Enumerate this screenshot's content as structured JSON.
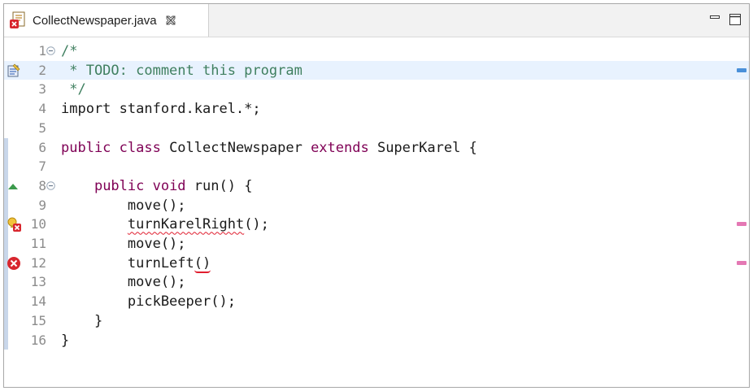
{
  "tab": {
    "title": "CollectNewspaper.java"
  },
  "colors": {
    "keyword": "#7f0055",
    "comment": "#3f7f5f",
    "error": "#e01e2f",
    "highlight_line": "#e8f2fe",
    "overview_task": "#4a90d9",
    "overview_error": "#e478b4"
  },
  "editor": {
    "lines": [
      {
        "num": "1",
        "folded": true,
        "tokens": [
          {
            "t": "/*",
            "c": "cm"
          }
        ]
      },
      {
        "num": "2",
        "tokens": [
          {
            "t": " * TODO: comment this program",
            "c": "cm"
          }
        ],
        "marker": "task-icon",
        "highlight": true
      },
      {
        "num": "3",
        "tokens": [
          {
            "t": " */",
            "c": "cm"
          }
        ]
      },
      {
        "num": "4",
        "tokens": [
          {
            "t": "import stanford.karel.*;",
            "c": ""
          }
        ]
      },
      {
        "num": "5",
        "tokens": []
      },
      {
        "num": "6",
        "tokens": [
          {
            "t": "public class ",
            "c": "kw"
          },
          {
            "t": "CollectNewspaper ",
            "c": ""
          },
          {
            "t": "extends ",
            "c": "kw"
          },
          {
            "t": "SuperKarel {",
            "c": ""
          }
        ]
      },
      {
        "num": "7",
        "tokens": []
      },
      {
        "num": "8",
        "folded": true,
        "marker": "override-icon",
        "tokens": [
          {
            "t": "    ",
            "c": ""
          },
          {
            "t": "public void ",
            "c": "kw"
          },
          {
            "t": "run() {",
            "c": ""
          }
        ]
      },
      {
        "num": "9",
        "tokens": [
          {
            "t": "        move();",
            "c": ""
          }
        ]
      },
      {
        "num": "10",
        "marker": "quickfix-error-icon",
        "tokens": [
          {
            "t": "        ",
            "c": ""
          },
          {
            "t": "turnKarelRight",
            "c": "err"
          },
          {
            "t": "();",
            "c": ""
          }
        ]
      },
      {
        "num": "11",
        "tokens": [
          {
            "t": "        move();",
            "c": ""
          }
        ]
      },
      {
        "num": "12",
        "marker": "error-icon",
        "tokens": [
          {
            "t": "        turnLeft",
            "c": ""
          },
          {
            "t": "()",
            "c": "errparen"
          }
        ]
      },
      {
        "num": "13",
        "tokens": [
          {
            "t": "        move();",
            "c": ""
          }
        ]
      },
      {
        "num": "14",
        "tokens": [
          {
            "t": "        pickBeeper();",
            "c": ""
          }
        ]
      },
      {
        "num": "15",
        "tokens": [
          {
            "t": "    }",
            "c": ""
          }
        ]
      },
      {
        "num": "16",
        "tokens": [
          {
            "t": "}",
            "c": ""
          }
        ]
      }
    ]
  },
  "overview_ruler": [
    {
      "line": "2",
      "kind": "task"
    },
    {
      "line": "10",
      "kind": "error"
    },
    {
      "line": "12",
      "kind": "error"
    }
  ]
}
